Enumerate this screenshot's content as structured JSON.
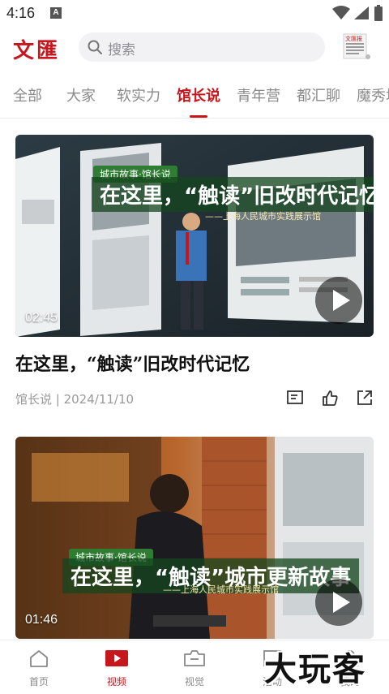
{
  "status_bar": {
    "time": "4:16",
    "notification_glyph": "A"
  },
  "header": {
    "logo": "文匯",
    "search_placeholder": "搜索",
    "paper_icon_caption": "文匯报"
  },
  "tabs": [
    {
      "label": "全部",
      "active": false
    },
    {
      "label": "大家",
      "active": false
    },
    {
      "label": "软实力",
      "active": false
    },
    {
      "label": "馆长说",
      "active": true
    },
    {
      "label": "青年营",
      "active": false
    },
    {
      "label": "都汇聊",
      "active": false
    },
    {
      "label": "魔秀场",
      "active": false
    }
  ],
  "cards": [
    {
      "overlay_label": "城市故事·馆长说",
      "overlay_title": "在这里，“触读”旧改时代记忆",
      "overlay_sub": "——上海人民城市实践展示馆",
      "duration": "02:45",
      "title": "在这里，“触读”旧改时代记忆",
      "meta": "馆长说 | 2024/11/10"
    },
    {
      "overlay_label": "城市故事·馆长说",
      "overlay_title": "在这里，“触读”城市更新故事",
      "overlay_sub": "——上海人民城市实践展示馆",
      "duration": "01:46"
    }
  ],
  "bottom_nav": [
    {
      "label": "首页",
      "icon": "home-icon",
      "active": false
    },
    {
      "label": "视频",
      "icon": "video-icon",
      "active": true
    },
    {
      "label": "视觉",
      "icon": "camera-icon",
      "active": false
    },
    {
      "label": "活动",
      "icon": "activity-icon",
      "active": false
    },
    {
      "label": "我的",
      "icon": "profile-icon",
      "active": false
    }
  ],
  "watermark": "大玩客",
  "colors": {
    "accent": "#c8161d",
    "muted": "#8a8a8a"
  }
}
